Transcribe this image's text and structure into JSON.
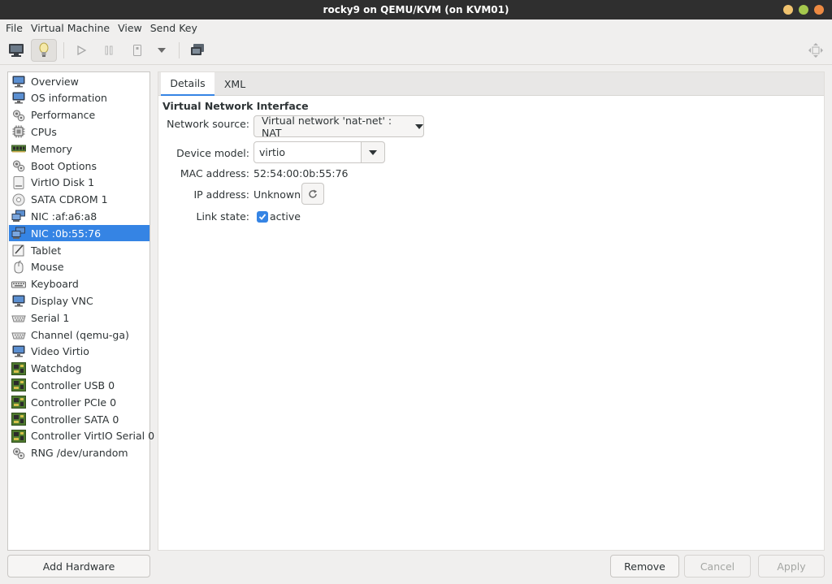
{
  "window": {
    "title": "rocky9 on QEMU/KVM (on KVM01)"
  },
  "colors": {
    "accent": "#3584e4",
    "close": "#ed8a42",
    "maximize": "#a5c84d",
    "minimize": "#f0c36f"
  },
  "menubar": [
    "File",
    "Virtual Machine",
    "View",
    "Send Key"
  ],
  "toolbar": {
    "buttons": [
      "monitor-icon",
      "lightbulb-icon",
      "play-icon",
      "pause-icon",
      "power-icon",
      "dropdown-icon",
      "snapshot-icon",
      "fullscreen-icon"
    ]
  },
  "sidebar": {
    "selected_index": 9,
    "items": [
      {
        "label": "Overview",
        "icon": "monitor-icon"
      },
      {
        "label": "OS information",
        "icon": "monitor-icon"
      },
      {
        "label": "Performance",
        "icon": "gears-icon"
      },
      {
        "label": "CPUs",
        "icon": "cpu-icon"
      },
      {
        "label": "Memory",
        "icon": "memory-icon"
      },
      {
        "label": "Boot Options",
        "icon": "gears-icon"
      },
      {
        "label": "VirtIO Disk 1",
        "icon": "disk-icon"
      },
      {
        "label": "SATA CDROM 1",
        "icon": "cdrom-icon"
      },
      {
        "label": "NIC :af:a6:a8",
        "icon": "network-icon"
      },
      {
        "label": "NIC :0b:55:76",
        "icon": "network-icon"
      },
      {
        "label": "Tablet",
        "icon": "tablet-icon"
      },
      {
        "label": "Mouse",
        "icon": "mouse-icon"
      },
      {
        "label": "Keyboard",
        "icon": "keyboard-icon"
      },
      {
        "label": "Display VNC",
        "icon": "monitor-icon"
      },
      {
        "label": "Serial 1",
        "icon": "serial-icon"
      },
      {
        "label": "Channel (qemu-ga)",
        "icon": "serial-icon"
      },
      {
        "label": "Video Virtio",
        "icon": "monitor-icon"
      },
      {
        "label": "Watchdog",
        "icon": "board-icon"
      },
      {
        "label": "Controller USB 0",
        "icon": "board-icon"
      },
      {
        "label": "Controller PCIe 0",
        "icon": "board-icon"
      },
      {
        "label": "Controller SATA 0",
        "icon": "board-icon"
      },
      {
        "label": "Controller VirtIO Serial 0",
        "icon": "board-icon"
      },
      {
        "label": "RNG /dev/urandom",
        "icon": "gears-icon"
      }
    ],
    "add_hardware_label": "Add Hardware"
  },
  "tabs": [
    {
      "label": "Details",
      "active": true
    },
    {
      "label": "XML",
      "active": false
    }
  ],
  "details": {
    "section_title": "Virtual Network Interface",
    "network_source": {
      "label": "Network source:",
      "value": "Virtual network 'nat-net' : NAT"
    },
    "device_model": {
      "label": "Device model:",
      "value": "virtio"
    },
    "mac_address": {
      "label": "MAC address:",
      "value": "52:54:00:0b:55:76"
    },
    "ip_address": {
      "label": "IP address:",
      "value": "Unknown"
    },
    "link_state": {
      "label": "Link state:",
      "value": "active",
      "checked": true
    }
  },
  "footer": {
    "remove_label": "Remove",
    "cancel_label": "Cancel",
    "apply_label": "Apply"
  }
}
